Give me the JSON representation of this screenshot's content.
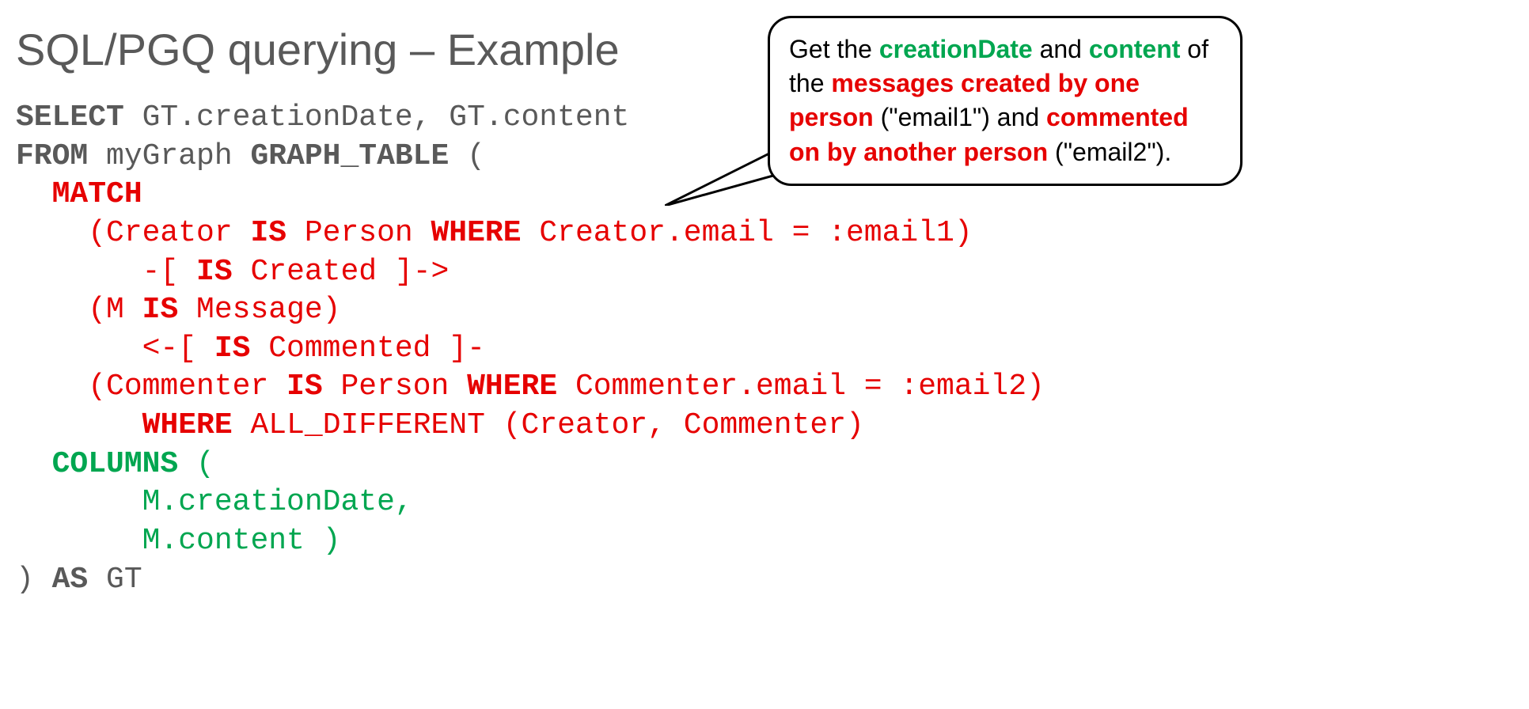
{
  "title": "SQL/PGQ querying – Example",
  "code": {
    "select": "SELECT",
    "select_cols": " GT.creationDate, GT.content",
    "from": "FROM",
    "from_table": " myGraph ",
    "graph_table": "GRAPH_TABLE",
    "open_paren": " (",
    "match": "MATCH",
    "line1_pre": "    (Creator ",
    "is1": "IS",
    "line1_mid": " Person ",
    "where1": "WHERE",
    "line1_post": " Creator.email = :email1)",
    "line2_pre": "       -[ ",
    "is2": "IS",
    "line2_post": " Created ]->",
    "line3_pre": "    (M ",
    "is3": "IS",
    "line3_post": " Message)",
    "line4_pre": "       <-[ ",
    "is4": "IS",
    "line4_post": " Commented ]-",
    "line5_pre": "    (Commenter ",
    "is5": "IS",
    "line5_mid": " Person ",
    "where5": "WHERE",
    "line5_post": " Commenter.email = :email2)",
    "where6": "WHERE",
    "line6_post": " ALL_DIFFERENT (Creator, Commenter)",
    "columns": "COLUMNS",
    "columns_open": " (",
    "col1": "       M.creationDate,",
    "col2": "       M.content )",
    "close_paren": ") ",
    "as": "AS",
    "as_alias": " GT"
  },
  "callout": {
    "t1": "Get the ",
    "t2": "creationDate",
    "t3": " and ",
    "t4": "content",
    "t5": " of the ",
    "t6": "messages created by one person",
    "t7": " (\"email1\") and ",
    "t8": "commented on by another person",
    "t9": " (\"email2\")."
  }
}
